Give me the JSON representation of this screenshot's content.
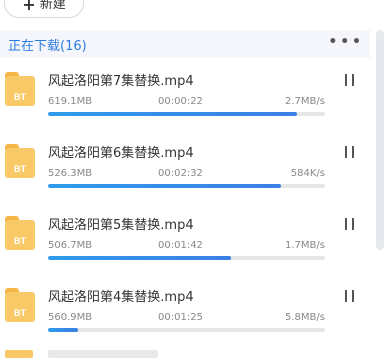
{
  "toolbar": {
    "new_label": "新建",
    "new_icon": "plus-icon"
  },
  "section": {
    "title": "正在下载(16)",
    "more_icon": "more-icon"
  },
  "colors": {
    "accent": "#2f7de1",
    "progress_start": "#2f9be9",
    "progress_end": "#3b7fe6",
    "file_icon": "#f9c867"
  },
  "downloads": [
    {
      "name": "风起洛阳第7集替换.mp4",
      "size": "619.1MB",
      "time": "00:00:22",
      "speed": "2.7MB/s",
      "progress": 0.9,
      "type_label": "BT"
    },
    {
      "name": "风起洛阳第6集替换.mp4",
      "size": "526.3MB",
      "time": "00:02:32",
      "speed": "584K/s",
      "progress": 0.84,
      "type_label": "BT"
    },
    {
      "name": "风起洛阳第5集替换.mp4",
      "size": "506.7MB",
      "time": "00:01:42",
      "speed": "1.7MB/s",
      "progress": 0.66,
      "type_label": "BT"
    },
    {
      "name": "风起洛阳第4集替换.mp4",
      "size": "560.9MB",
      "time": "00:01:25",
      "speed": "5.8MB/s",
      "progress": 0.11,
      "type_label": "BT"
    }
  ]
}
